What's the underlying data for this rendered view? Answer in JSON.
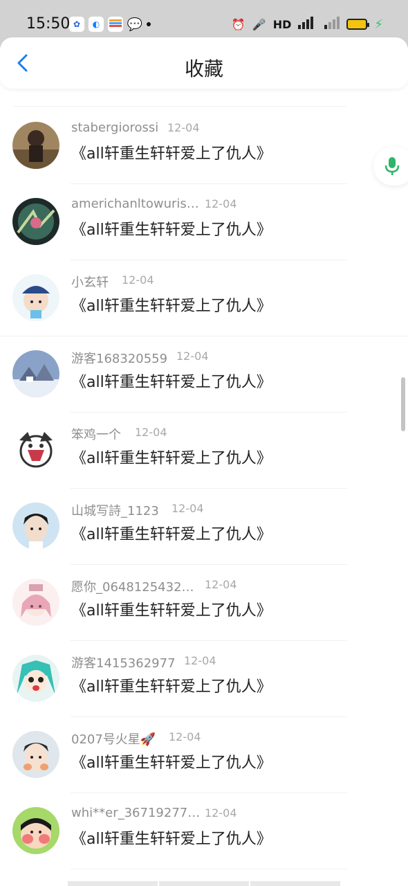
{
  "status_bar": {
    "time": "15:50",
    "right_text": "HD"
  },
  "header": {
    "title": "收藏"
  },
  "colors": {
    "accent": "#1e7cf0",
    "mic_green": "#2fb56a"
  },
  "items": [
    {
      "username": "stabergiorossi",
      "date": "12-04",
      "title": "《all轩重生轩轩爱上了仇人》",
      "avatar": "avatar-1"
    },
    {
      "username": "americhanltowuris…",
      "date": "12-04",
      "title": "《all轩重生轩轩爱上了仇人》",
      "avatar": "avatar-2"
    },
    {
      "username": "小玄轩",
      "date": "12-04",
      "title": "《all轩重生轩轩爱上了仇人》",
      "avatar": "avatar-3"
    },
    {
      "username": "游客168320559",
      "date": "12-04",
      "title": "《all轩重生轩轩爱上了仇人》",
      "avatar": "avatar-4"
    },
    {
      "username": "笨鸡一个",
      "date": "12-04",
      "title": "《all轩重生轩轩爱上了仇人》",
      "avatar": "avatar-5"
    },
    {
      "username": "山城写詩_1123",
      "date": "12-04",
      "title": "《all轩重生轩轩爱上了仇人》",
      "avatar": "avatar-6"
    },
    {
      "username": "愿你_0648125432…",
      "date": "12-04",
      "title": "《all轩重生轩轩爱上了仇人》",
      "avatar": "avatar-7"
    },
    {
      "username": "游客1415362977",
      "date": "12-04",
      "title": "《all轩重生轩轩爱上了仇人》",
      "avatar": "avatar-8"
    },
    {
      "username": "0207号火星🚀",
      "date": "12-04",
      "title": "《all轩重生轩轩爱上了仇人》",
      "avatar": "avatar-9"
    },
    {
      "username": "whi**er_36719277…",
      "date": "12-04",
      "title": "《all轩重生轩轩爱上了仇人》",
      "avatar": "avatar-10"
    }
  ]
}
